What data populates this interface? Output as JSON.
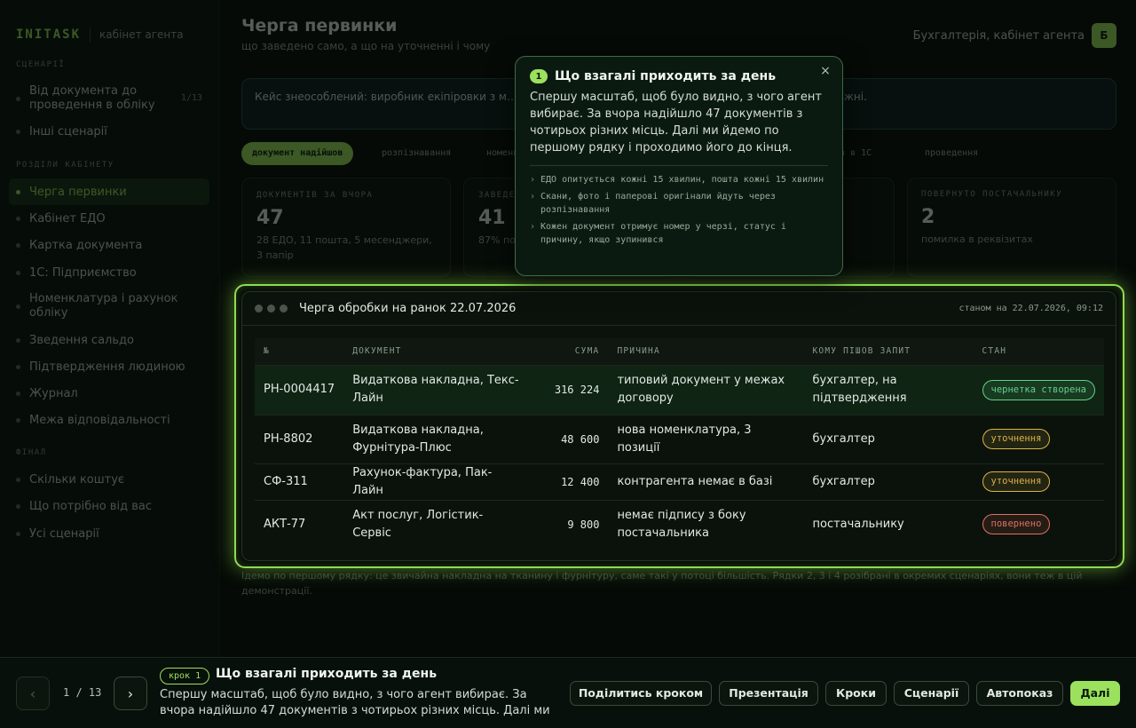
{
  "colors": {
    "accent": "#9be15d",
    "badge_green": "#5fd38a",
    "badge_yellow": "#d9b24a",
    "badge_red": "#e0705f"
  },
  "sidebar": {
    "logo": "INITASK",
    "subtitle": "кабінет агента",
    "sections": [
      {
        "title": "СЦЕНАРІЇ",
        "items": [
          {
            "label": "Від документа до проведення в обліку",
            "count": "1/13",
            "active": false
          },
          {
            "label": "Інші сценарії",
            "count": "",
            "active": false
          }
        ]
      },
      {
        "title": "РОЗДІЛИ КАБІНЕТУ",
        "items": [
          {
            "label": "Черга первинки",
            "count": "",
            "active": true
          },
          {
            "label": "Кабінет ЕДО",
            "count": "",
            "active": false
          },
          {
            "label": "Картка документа",
            "count": "",
            "active": false
          },
          {
            "label": "1С: Підприємство",
            "count": "",
            "active": false
          },
          {
            "label": "Номенклатура і рахунок обліку",
            "count": "",
            "active": false
          },
          {
            "label": "Зведення сальдо",
            "count": "",
            "active": false
          },
          {
            "label": "Підтвердження людиною",
            "count": "",
            "active": false
          },
          {
            "label": "Журнал",
            "count": "",
            "active": false
          },
          {
            "label": "Межа відповідальності",
            "count": "",
            "active": false
          }
        ]
      },
      {
        "title": "ФІНАЛ",
        "items": [
          {
            "label": "Скільки коштує",
            "count": "",
            "active": false
          },
          {
            "label": "Що потрібно від вас",
            "count": "",
            "active": false
          },
          {
            "label": "Усі сценарії",
            "count": "",
            "active": false
          }
        ]
      }
    ]
  },
  "header": {
    "title": "Черга первинки",
    "subtitle": "що заведено само, а що на уточненні і чому",
    "account": "Бухгалтерія, кабінет агента",
    "avatar": "Б"
  },
  "notice": "Кейс знеособлений: виробник екіпіровки з м… …ументів і суми змінені, порядок обробки і екрани справжні.",
  "pills": [
    "документ надійшов",
    "розпізнавання",
    "номенклатура",
    "",
    "ка в 1С",
    "проведення"
  ],
  "stats": [
    {
      "label": "ДОКУМЕНТІВ ЗА ВЧОРА",
      "value": "47",
      "desc": "28 ЕДО, 11 пошта, 5 месенджери, 3 папір"
    },
    {
      "label": "ЗАВЕДЕНО САМО",
      "value": "41",
      "desc": "87% по…"
    },
    {
      "label": "",
      "value": "",
      "desc": ""
    },
    {
      "label": "",
      "value": "",
      "desc": ""
    },
    {
      "label": "ПОВЕРНУТО ПОСТАЧАЛЬНИКУ",
      "value": "2",
      "desc": "помилка в реквізитах"
    }
  ],
  "table_card": {
    "title": "Черга обробки на ранок 22.07.2026",
    "stamp": "станом на 22.07.2026, 09:12",
    "columns": [
      "№",
      "ДОКУМЕНТ",
      "СУМА",
      "ПРИЧИНА",
      "КОМУ ПІШОВ ЗАПИТ",
      "СТАН"
    ],
    "rows": [
      {
        "id": "РН-0004417",
        "doc": "Видаткова накладна, Текс-Лайн",
        "sum": "316 224",
        "reason": "типовий документ у межах договору",
        "to": "бухгалтер, на підтвердження",
        "status": "чернетка створена",
        "kind": "green"
      },
      {
        "id": "РН-8802",
        "doc": "Видаткова накладна, Фурнітура-Плюс",
        "sum": "48 600",
        "reason": "нова номенклатура, 3 позиції",
        "to": "бухгалтер",
        "status": "уточнення",
        "kind": "yellow"
      },
      {
        "id": "СФ-311",
        "doc": "Рахунок-фактура, Пак-Лайн",
        "sum": "12 400",
        "reason": "контрагента немає в базі",
        "to": "бухгалтер",
        "status": "уточнення",
        "kind": "yellow"
      },
      {
        "id": "АКТ-77",
        "doc": "Акт послуг, Логістик-Сервіс",
        "sum": "9 800",
        "reason": "немає підпису з боку постачальника",
        "to": "постачальнику",
        "status": "повернено",
        "kind": "red"
      }
    ]
  },
  "footnote": "Ідемо по першому рядку: це звичайна накладна на тканину і фурнітуру, саме такі у потоці більшість. Рядки 2, 3 і 4 розібрані в окремих сценаріях, вони теж в цій демонстрації.",
  "popover": {
    "step": "1",
    "title": "Що взагалі приходить за день",
    "body": "Спершу масштаб, щоб було видно, з чого агент вибирає. За вчора надійшло 47 документів з чотирьох різних місць. Далі ми йдемо по першому рядку і проходимо його до кінця.",
    "bullets": [
      "ЕДО опитується кожні 15 хвилин, пошта кожні 15 хвилин",
      "Скани, фото і паперові оригінали йдуть через розпізнавання",
      "Кожен документ отримує номер у черзі, статус і причину, якщо зупинився"
    ],
    "close": "×"
  },
  "tour": {
    "prev": "‹",
    "next": "›",
    "counter": "1 / 13",
    "step_tag": "крок 1",
    "title": "Що взагалі приходить за день",
    "text": "Спершу масштаб, щоб було видно, з чого агент вибирає. За вчора надійшло 47 документів з чотирьох різних місць. Далі ми йдемо …",
    "buttons": {
      "share": "Поділитись кроком",
      "presentation": "Презентація",
      "steps": "Кроки",
      "scenarios": "Сценарії",
      "autoplay": "Автопоказ",
      "next": "Далі"
    }
  }
}
